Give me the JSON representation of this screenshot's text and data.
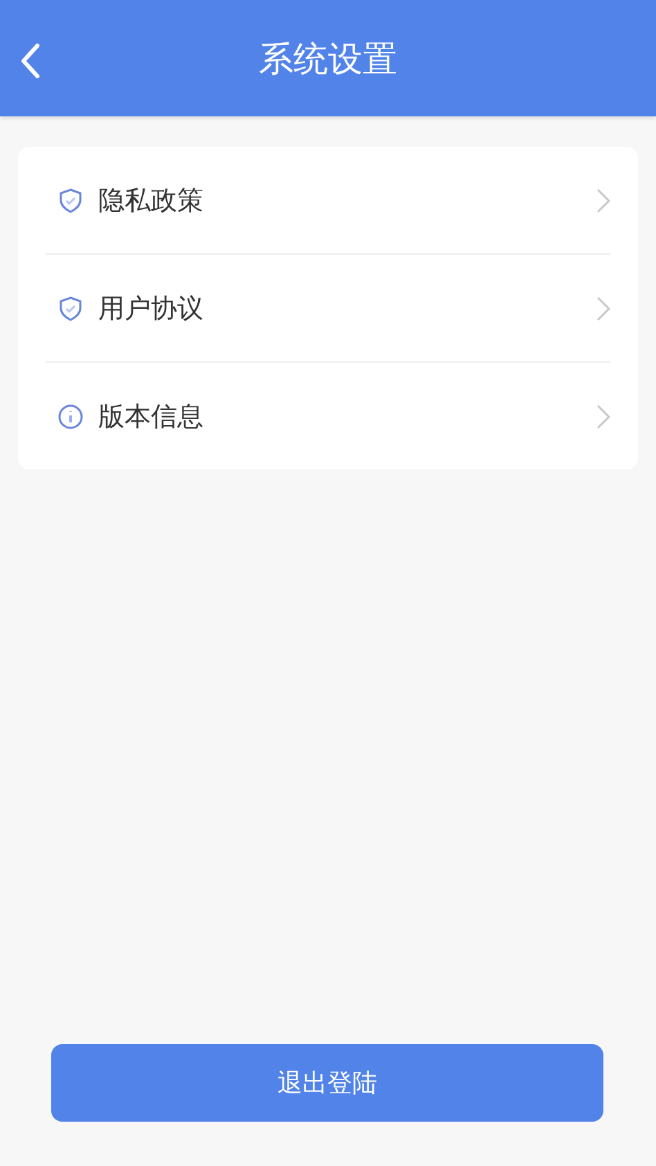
{
  "header": {
    "title": "系统设置"
  },
  "menu": [
    {
      "kind": "shield",
      "label": "隐私政策"
    },
    {
      "kind": "shield",
      "label": "用户协议"
    },
    {
      "kind": "info",
      "label": "版本信息"
    }
  ],
  "logout_button": "退出登陆"
}
